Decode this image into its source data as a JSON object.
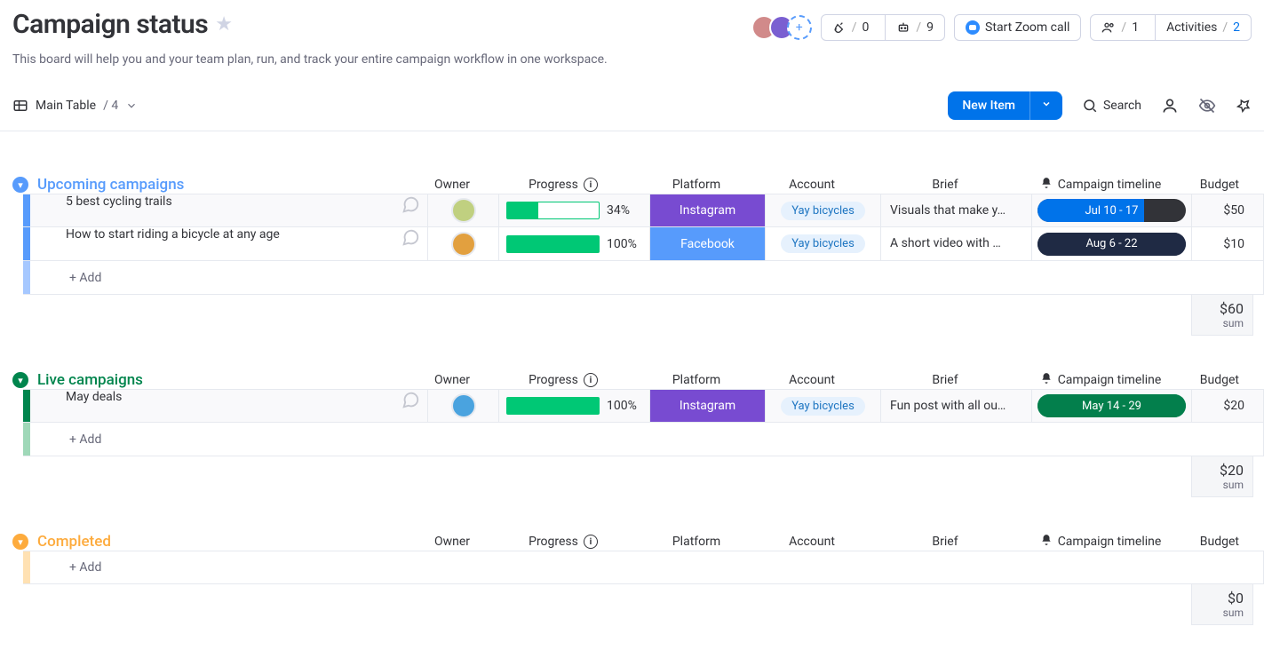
{
  "board": {
    "title": "Campaign status",
    "description": "This board will help you and your team plan, run, and track your entire campaign workflow in one workspace."
  },
  "header": {
    "integrations_count": "0",
    "automations_count": "9",
    "zoom_label": "Start Zoom call",
    "members_count": "1",
    "activities_label": "Activities",
    "activities_count": "2"
  },
  "view": {
    "name": "Main Table",
    "count": "4",
    "new_item_label": "New Item",
    "search_label": "Search"
  },
  "columns": {
    "owner": "Owner",
    "progress": "Progress",
    "platform": "Platform",
    "account": "Account",
    "brief": "Brief",
    "timeline": "Campaign timeline",
    "budget": "Budget"
  },
  "groups": [
    {
      "id": "upcoming",
      "name": "Upcoming campaigns",
      "color_class": "blue",
      "rows": [
        {
          "name": "5 best cycling trails",
          "owner_color": "#c0d080",
          "progress_pct": 34,
          "progress_label": "34%",
          "platform": "Instagram",
          "platform_color": "#784bd1",
          "account": "Yay bicycles",
          "brief": "Visuals that make y…",
          "timeline": "Jul 10 - 17",
          "timeline_bg": "#323338",
          "timeline_fill": "#0073ea",
          "timeline_fill_pct": 72,
          "budget": "$50"
        },
        {
          "name": "How to start riding a bicycle at any age",
          "owner_color": "#e2a03f",
          "progress_pct": 100,
          "progress_label": "100%",
          "platform": "Facebook",
          "platform_color": "#579bfc",
          "account": "Yay bicycles",
          "brief": "A short video with …",
          "timeline": "Aug 6 - 22",
          "timeline_bg": "#1f2a44",
          "timeline_fill": "#1f2a44",
          "timeline_fill_pct": 100,
          "budget": "$10"
        }
      ],
      "add_label": "+ Add",
      "sum": "$60",
      "sum_label": "sum"
    },
    {
      "id": "live",
      "name": "Live campaigns",
      "color_class": "green",
      "rows": [
        {
          "name": "May deals",
          "owner_color": "#4aa3df",
          "progress_pct": 100,
          "progress_label": "100%",
          "platform": "Instagram",
          "platform_color": "#784bd1",
          "account": "Yay bicycles",
          "brief": "Fun post with all ou…",
          "timeline": "May 14 - 29",
          "timeline_bg": "#037f4c",
          "timeline_fill": "#037f4c",
          "timeline_fill_pct": 100,
          "budget": "$20"
        }
      ],
      "add_label": "+ Add",
      "sum": "$20",
      "sum_label": "sum"
    },
    {
      "id": "completed",
      "name": "Completed",
      "color_class": "orange",
      "rows": [],
      "add_label": "+ Add",
      "sum": "$0",
      "sum_label": "sum"
    }
  ]
}
